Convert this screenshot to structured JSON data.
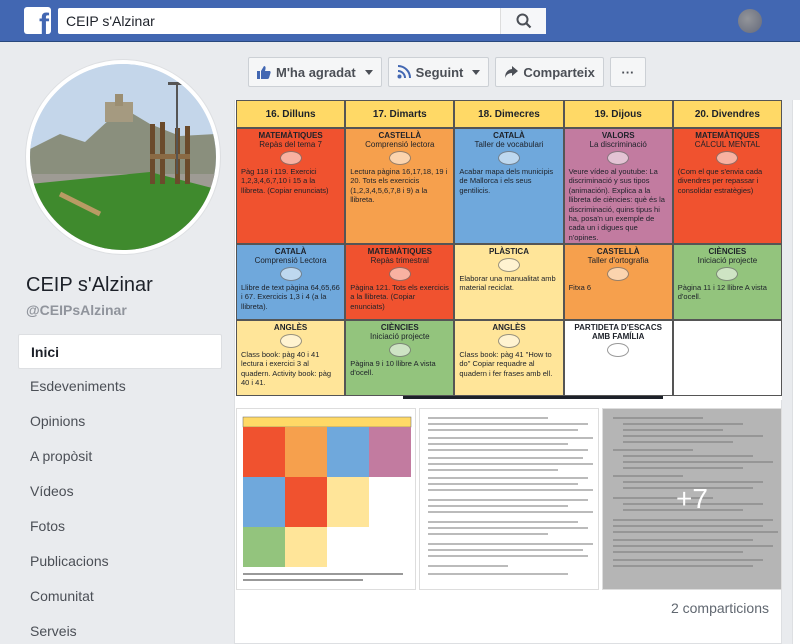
{
  "topbar": {
    "logo": "f",
    "search_value": "CEIP s'Alzinar"
  },
  "page": {
    "name": "CEIP s'Alzinar",
    "handle": "@CEIPsAlzinar"
  },
  "nav": {
    "items": [
      {
        "label": "Inici",
        "active": true
      },
      {
        "label": "Esdeveniments"
      },
      {
        "label": "Opinions"
      },
      {
        "label": "A propòsit"
      },
      {
        "label": "Vídeos"
      },
      {
        "label": "Fotos"
      },
      {
        "label": "Publicacions"
      },
      {
        "label": "Comunitat"
      },
      {
        "label": "Serveis"
      }
    ]
  },
  "actions": {
    "like": "M'ha agradat",
    "follow": "Seguint",
    "share": "Comparteix",
    "more": "···"
  },
  "schedule": {
    "days": [
      "16. Dilluns",
      "17. Dimarts",
      "18. Dimecres",
      "19. Dijous",
      "20. Divendres"
    ],
    "row1": [
      {
        "subject": "MATEMÀTIQUES",
        "sub": "Repàs del tema 7",
        "text": "Pàg 118 i 119. Exercici 1,2,3,4,6,7,10 i 15 a la llibreta. (Copiar enunciats)",
        "color": "#f0522f"
      },
      {
        "subject": "CASTELLÀ",
        "sub": "Comprensió lectora",
        "text": "Lectura pàgina 16,17,18, 19 i 20. Tots els exercicis (1,2,3,4,5,6,7,8 i 9) a la llibreta.",
        "color": "#f6a04d"
      },
      {
        "subject": "CATALÀ",
        "sub": "Taller de vocabulari",
        "text": "Acabar mapa dels municipis de Mallorca i els seus gentilicis.",
        "color": "#6fa8dc"
      },
      {
        "subject": "VALORS",
        "sub": "La discriminació",
        "text": "Veure vídeo al youtube: La discriminació y sus tipos (animación). Explica a la llibreta de ciències: què és la discriminació, quins tipus hi ha, posa'n un exemple de cada un i digues que n'opines.",
        "color": "#c27ba0"
      },
      {
        "subject": "MATEMÀTIQUES",
        "sub": "CÀLCUL MENTAL",
        "text": "(Com el que s'envia cada divendres per repassar i consolidar estratègies)",
        "color": "#f0522f"
      }
    ],
    "row2": [
      {
        "subject": "CATALÀ",
        "sub": "Comprensió Lectora",
        "text": "Llibre de text pàgina 64,65,66 i 67. Exercicis 1,3 i 4 (a la llibreta).",
        "color": "#6fa8dc"
      },
      {
        "subject": "MATEMÀTIQUES",
        "sub": "Repàs trimestral",
        "text": "Pàgina 121. Tots els exercicis a la llibreta. (Copiar enunciats)",
        "color": "#f0522f"
      },
      {
        "subject": "PLÀSTICA",
        "sub": "",
        "text": "Elaborar una manualitat amb material reciclat.",
        "color": "#ffe599"
      },
      {
        "subject": "CASTELLÀ",
        "sub": "Taller d'ortografia",
        "text": "Fitxa 6",
        "color": "#f6a04d"
      },
      {
        "subject": "CIÈNCIES",
        "sub": "Iniciació projecte",
        "text": "Pàgina 11 i 12 llibre A vista d'ocell.",
        "color": "#93c47d"
      }
    ],
    "row3": [
      {
        "subject": "ANGLÈS",
        "sub": "",
        "text": "Class book: pàg 40 i 41 lectura i exercici 3 al quadern. Activity book: pàg 40 i 41.",
        "color": "#ffe599"
      },
      {
        "subject": "CIÈNCIES",
        "sub": "Iniciació projecte",
        "text": "Pàgina 9 i 10 llibre A vista d'ocell.",
        "color": "#93c47d"
      },
      {
        "subject": "ANGLÈS",
        "sub": "",
        "text": "Class book: pàg 41 \"How to do\" Copiar requadre al quadern i fer frases amb ell.",
        "color": "#ffe599"
      },
      {
        "subject": "PARTIDETA D'ESCACS AMB FAMÍLIA",
        "sub": "",
        "text": "",
        "color": "#ffffff"
      },
      {
        "subject": "",
        "sub": "",
        "text": "",
        "color": "#ffffff"
      }
    ]
  },
  "thumbs": {
    "more_label": "+7"
  },
  "post": {
    "shares": "2 comparticions"
  },
  "colors": {
    "header_blue": "#4267b2",
    "day_yellow": "#ffd966"
  }
}
